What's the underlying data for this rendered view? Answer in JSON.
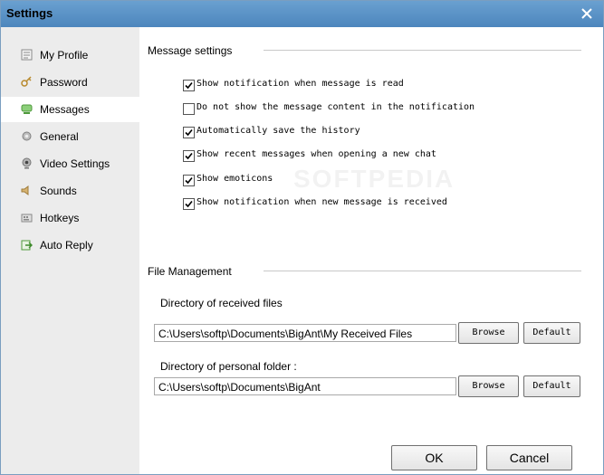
{
  "window": {
    "title": "Settings"
  },
  "sidebar": {
    "items": [
      {
        "label": "My Profile",
        "icon": "profile-card-icon"
      },
      {
        "label": "Password",
        "icon": "key-icon"
      },
      {
        "label": "Messages",
        "icon": "message-icon",
        "selected": true
      },
      {
        "label": "General",
        "icon": "gear-icon"
      },
      {
        "label": "Video Settings",
        "icon": "webcam-icon"
      },
      {
        "label": "Sounds",
        "icon": "speaker-icon"
      },
      {
        "label": "Hotkeys",
        "icon": "keyboard-icon"
      },
      {
        "label": "Auto Reply",
        "icon": "reply-icon"
      }
    ]
  },
  "message_settings": {
    "title": "Message settings",
    "options": [
      {
        "label": "Show notification when message is read",
        "checked": true
      },
      {
        "label": "Do not show the message content in the notification",
        "checked": false
      },
      {
        "label": "Automatically save the history",
        "checked": true
      },
      {
        "label": "Show recent messages when opening a new chat",
        "checked": true
      },
      {
        "label": "Show emoticons",
        "checked": true
      },
      {
        "label": "Show notification when new message is received",
        "checked": true
      }
    ]
  },
  "file_management": {
    "title": "File Management",
    "received": {
      "label": "Directory of received files",
      "value": "C:\\Users\\softp\\Documents\\BigAnt\\My Received Files",
      "browse": "Browse",
      "default": "Default"
    },
    "personal": {
      "label": "Directory of personal folder :",
      "value": "C:\\Users\\softp\\Documents\\BigAnt",
      "browse": "Browse",
      "default": "Default"
    }
  },
  "footer": {
    "ok": "OK",
    "cancel": "Cancel"
  },
  "watermark": "SOFTPEDIA",
  "colors": {
    "titlebar": "#5b93c7",
    "sidebar": "#ececec",
    "selected": "#ffffff"
  }
}
